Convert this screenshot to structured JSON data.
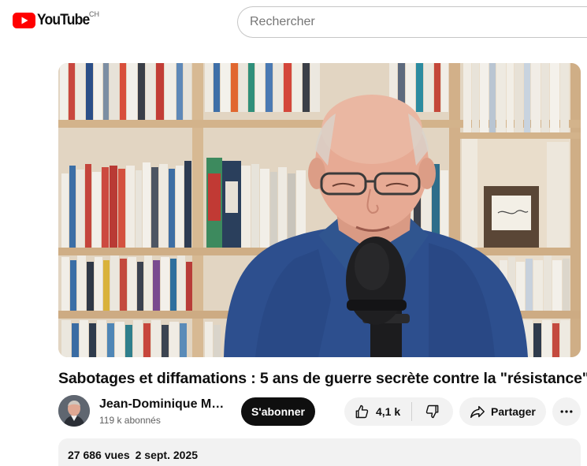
{
  "masthead": {
    "logo_text": "YouTube",
    "country_code": "CH",
    "search_placeholder": "Rechercher",
    "brand_color": "#ff0000"
  },
  "video": {
    "title": "Sabotages et diffamations : 5 ans de guerre secrète contre la \"résistance\"",
    "thumbnail_icon": "video-frame-man-speaking-into-microphone-in-front-of-bookshelves"
  },
  "owner": {
    "channel_name": "Jean-Dominique Michel",
    "subscribers": "119 k abonnés",
    "subscribe_label": "S'abonner"
  },
  "actions": {
    "like_count": "4,1 k",
    "share_label": "Partager",
    "like_icon": "thumb-up-icon",
    "dislike_icon": "thumb-down-icon",
    "share_icon": "share-arrow-icon",
    "more_icon": "more-horizontal-icon"
  },
  "description": {
    "views": "27 686 vues",
    "date": "2 sept. 2025"
  }
}
